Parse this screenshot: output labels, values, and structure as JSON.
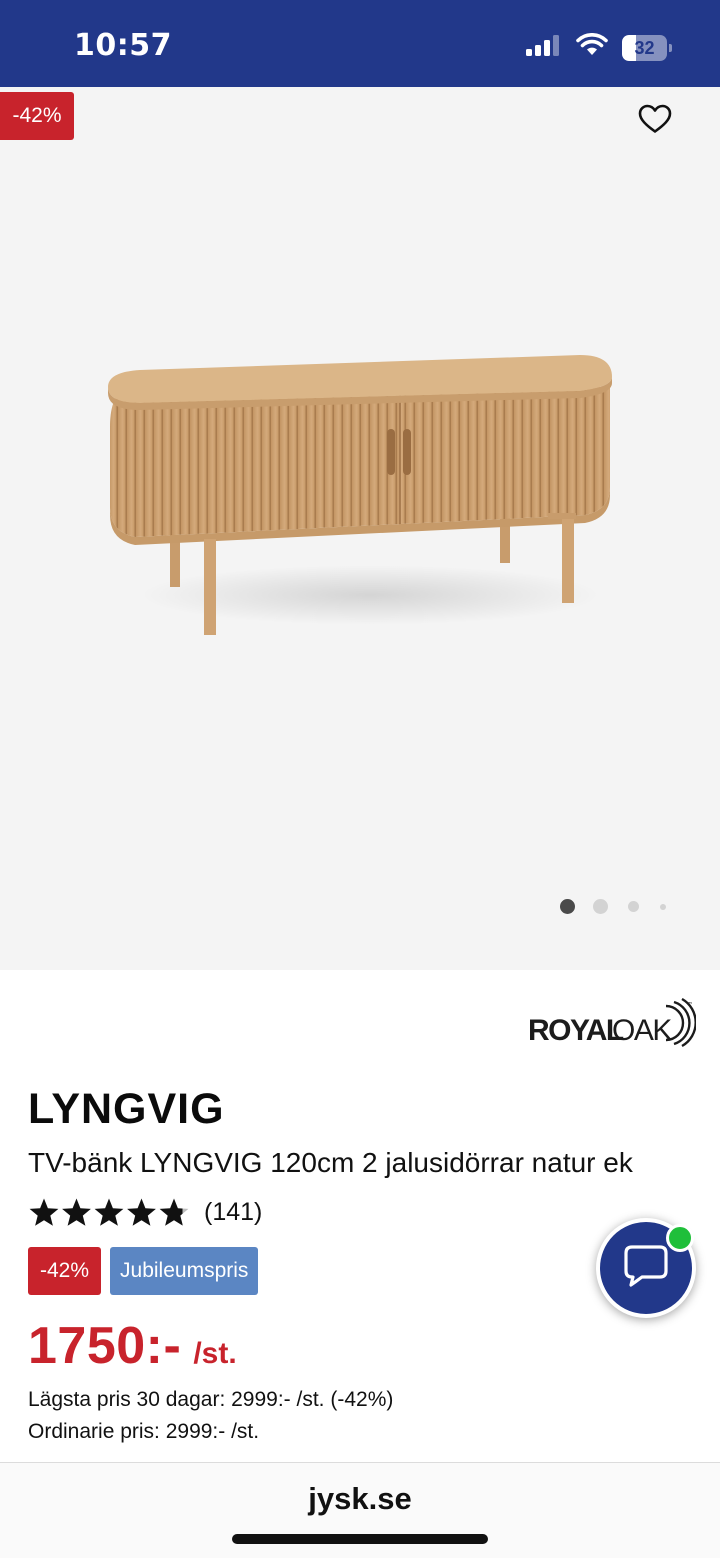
{
  "status_bar": {
    "time": "10:57",
    "battery_level": "32",
    "battery_fraction": 0.32,
    "icons": [
      "cellular-signal-icon",
      "wifi-icon",
      "battery-icon"
    ]
  },
  "gallery": {
    "discount_badge": "-42%",
    "wishlist_icon": "heart-outline-icon",
    "image_count": 4,
    "active_index": 0
  },
  "product": {
    "brand": "ROYAL OAK",
    "brand_word1": "ROYAL",
    "brand_word2": "OAK",
    "brand_tm": "™",
    "name": "LYNGVIG",
    "description": "TV-bänk LYNGVIG 120cm 2 jalusidörrar natur ek",
    "rating_stars": 4.8,
    "rating_max": 5,
    "rating_count": "(141)",
    "discount_label": "-42%",
    "campaign_label": "Jubileumspris",
    "price": "1750:-",
    "price_unit": "/st.",
    "lowest_price_note": "Lägsta pris 30 dagar: 2999:- /st. (-42%)",
    "regular_price_note": "Ordinarie pris: 2999:- /st."
  },
  "chat": {
    "icon": "chat-bubble-icon",
    "online": true
  },
  "browser": {
    "url": "jysk.se"
  },
  "colors": {
    "brand_blue": "#22388a",
    "sale_red": "#c8232c",
    "campaign_blue": "#5b86c3",
    "online_green": "#1fbf3a"
  }
}
